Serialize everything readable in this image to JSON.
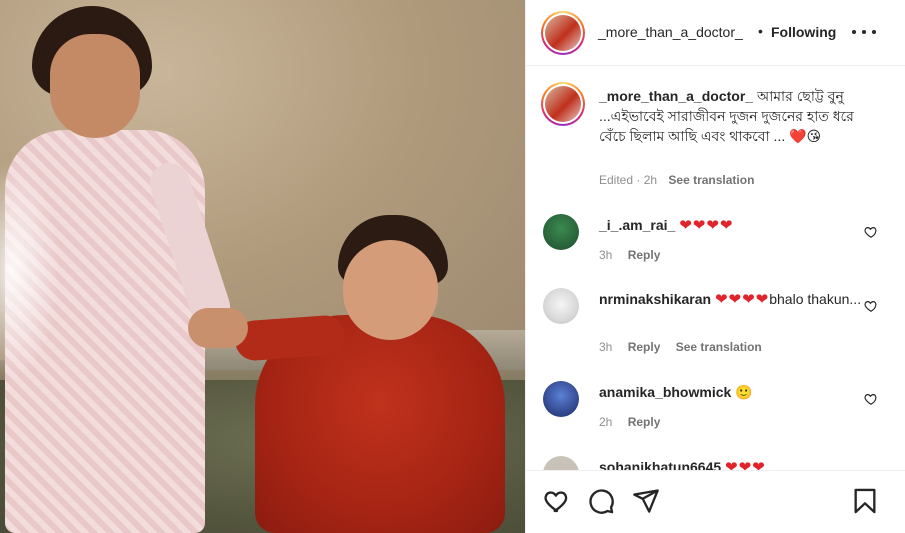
{
  "header": {
    "username": "_more_than_a_doctor_",
    "separator": "•",
    "follow_label": "Following"
  },
  "caption": {
    "username": "_more_than_a_doctor_",
    "text": "আমার ছোট্ট বুনু ...এইভাবেই সারাজীবন দুজন দুজনের হাত ধরে বেঁচে ছিলাম আছি এবং থাকবো ...",
    "emoji": "❤️😘",
    "edited": "Edited · 2h",
    "see_translation": "See translation"
  },
  "comments": [
    {
      "username": "_i_.am_rai_",
      "text": "",
      "emoji": "❤❤❤❤",
      "time": "3h",
      "reply": "Reply",
      "translate": ""
    },
    {
      "username": "nrminakshikaran",
      "text": "bhalo thakun...",
      "emoji": "❤❤❤❤",
      "time": "3h",
      "reply": "Reply",
      "translate": "See translation"
    },
    {
      "username": "anamika_bhowmick",
      "text": "",
      "emoji": "🙂",
      "time": "2h",
      "reply": "Reply",
      "translate": ""
    },
    {
      "username": "sohanikhatun6645",
      "text": "",
      "emoji": "❤❤❤",
      "time": "",
      "reply": "",
      "translate": ""
    }
  ],
  "actions": {
    "icons": [
      "heart-icon",
      "comment-icon",
      "share-icon",
      "bookmark-icon"
    ]
  },
  "colors": {
    "heart": "#e0242b",
    "text": "#262626",
    "muted": "#8e8e8e"
  }
}
